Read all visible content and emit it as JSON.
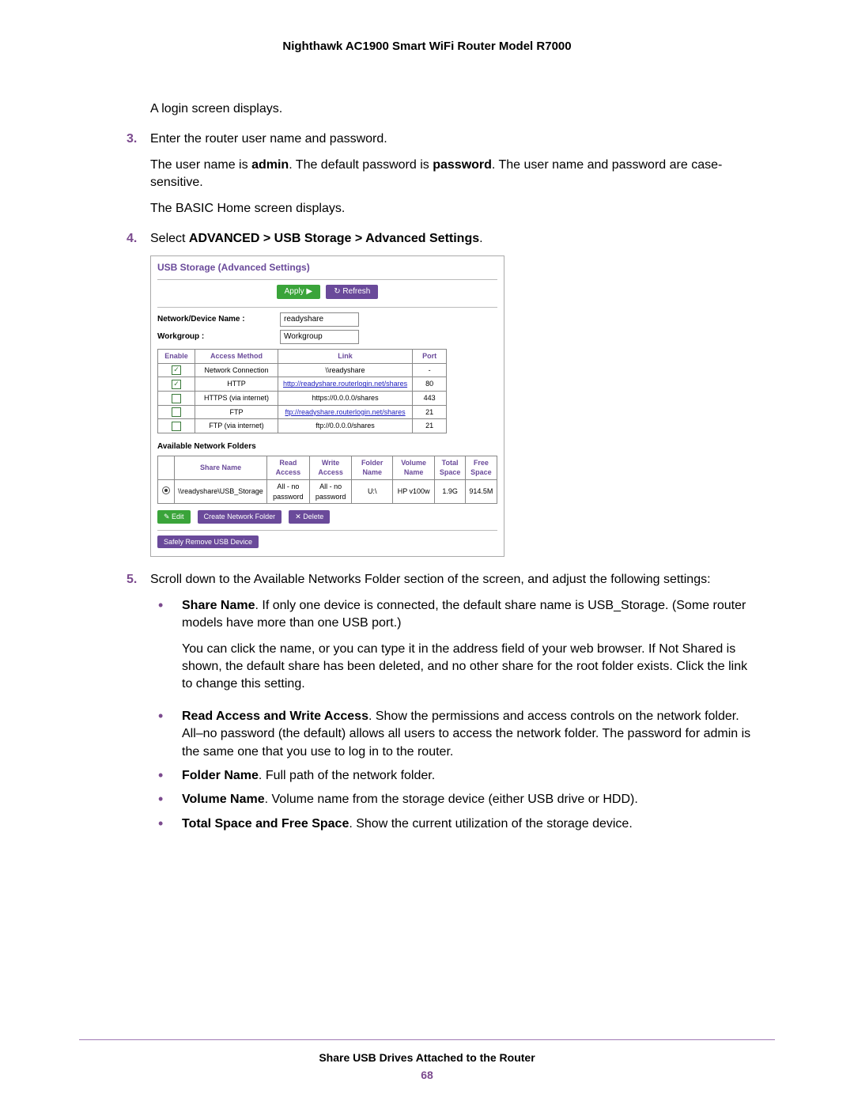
{
  "header": "Nighthawk AC1900 Smart WiFi Router Model R7000",
  "p1": "A login screen displays.",
  "step3_num": "3.",
  "step3_text": "Enter the router user name and password.",
  "p2a": "The user name is ",
  "p2b": "admin",
  "p2c": ". The default password is ",
  "p2d": "password",
  "p2e": ". The user name and password are case-sensitive.",
  "p3": "The BASIC Home screen displays.",
  "step4_num": "4.",
  "step4_a": "Select ",
  "step4_b": "ADVANCED > USB Storage > Advanced Settings",
  "step4_c": ".",
  "ss": {
    "title": "USB Storage (Advanced Settings)",
    "apply": "Apply ▶",
    "refresh": "↻ Refresh",
    "netdev_label": "Network/Device Name :",
    "netdev_value": "readyshare",
    "workgroup_label": "Workgroup :",
    "workgroup_value": "Workgroup",
    "th_enable": "Enable",
    "th_method": "Access Method",
    "th_link": "Link",
    "th_port": "Port",
    "rows": [
      {
        "checked": true,
        "method": "Network Connection",
        "link": "\\\\readyshare",
        "is_link": false,
        "port": "-"
      },
      {
        "checked": true,
        "method": "HTTP",
        "link": "http://readyshare.routerlogin.net/shares",
        "is_link": true,
        "port": "80"
      },
      {
        "checked": false,
        "method": "HTTPS (via internet)",
        "link": "https://0.0.0.0/shares",
        "is_link": false,
        "port": "443"
      },
      {
        "checked": false,
        "method": "FTP",
        "link": "ftp://readyshare.routerlogin.net/shares",
        "is_link": true,
        "port": "21"
      },
      {
        "checked": false,
        "method": "FTP (via internet)",
        "link": "ftp://0.0.0.0/shares",
        "is_link": false,
        "port": "21"
      }
    ],
    "avail_hdr": "Available Network Folders",
    "fth": {
      "share": "Share Name",
      "read": "Read Access",
      "write": "Write Access",
      "folder": "Folder Name",
      "volume": "Volume Name",
      "total": "Total Space",
      "free": "Free Space"
    },
    "frow": {
      "share": "\\\\readyshare\\USB_Storage",
      "read": "All - no password",
      "write": "All - no password",
      "folder": "U:\\",
      "volume": "HP v100w",
      "total": "1.9G",
      "free": "914.5M"
    },
    "edit": "✎ Edit",
    "create": "Create Network Folder",
    "delete": "✕ Delete",
    "remove": "Safely Remove USB Device"
  },
  "step5_num": "5.",
  "step5_text": "Scroll down to the Available Networks Folder section of the screen, and adjust the following settings:",
  "b1_label": "Share Name",
  "b1_text1": ". If only one device is connected, the default share name is USB_Storage. (Some router models have more than one USB port.)",
  "b1_text2": "You can click the name, or you can type it in the address field of your web browser. If Not Shared is shown, the default share has been deleted, and no other share for the root folder exists. Click the link to change this setting.",
  "b2_label": "Read Access and Write Access",
  "b2_text": ". Show the permissions and access controls on the network folder. All–no password (the default) allows all users to access the network folder. The password for admin is the same one that you use to log in to the router.",
  "b3_label": "Folder Name",
  "b3_text": ". Full path of the network folder.",
  "b4_label": "Volume Name",
  "b4_text": ". Volume name from the storage device (either USB drive or HDD).",
  "b5_label": "Total Space and Free Space",
  "b5_text": ". Show the current utilization of the storage device.",
  "footer_title": "Share USB Drives Attached to the Router",
  "page_number": "68"
}
